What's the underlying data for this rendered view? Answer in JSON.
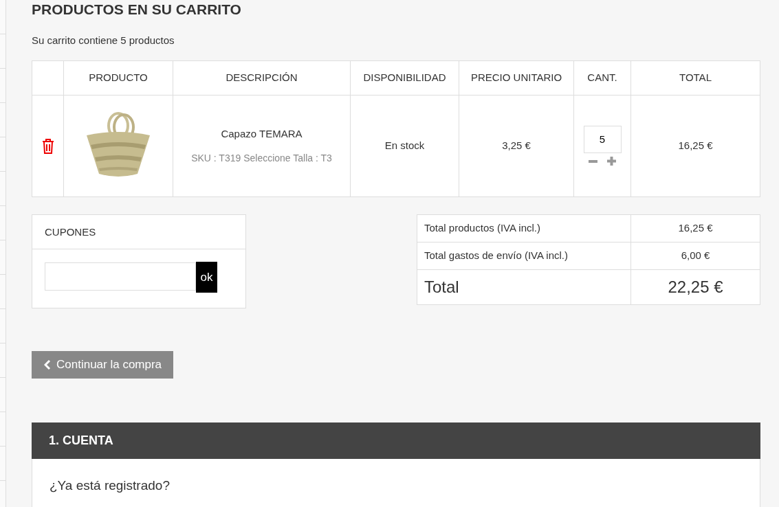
{
  "title": "PRODUCTOS EN SU CARRITO",
  "summary": "Su carrito contiene 5 productos",
  "cart": {
    "columns": [
      "",
      "PRODUCTO",
      "DESCRIPCIÓN",
      "DISPONIBILIDAD",
      "PRECIO UNITARIO",
      "CANT.",
      "TOTAL"
    ],
    "rows": [
      {
        "name": "Capazo TEMARA",
        "details": "SKU : T319 Seleccione Talla : T3",
        "availability": "En stock",
        "unit_price": "3,25 €",
        "quantity": "5",
        "total": "16,25 €"
      }
    ]
  },
  "coupons": {
    "title": "CUPONES",
    "button": "ok"
  },
  "totals": [
    {
      "kind": "line",
      "label": "Total productos (IVA incl.)",
      "value": "16,25 €"
    },
    {
      "kind": "line",
      "label": "Total gastos de envío (IVA incl.)",
      "value": "6,00 €"
    },
    {
      "kind": "grand",
      "label": "Total",
      "value": "22,25 €"
    }
  ],
  "continue_button": "Continuar la compra",
  "account": {
    "title": "1. CUENTA",
    "question": "¿Ya está registrado?"
  }
}
